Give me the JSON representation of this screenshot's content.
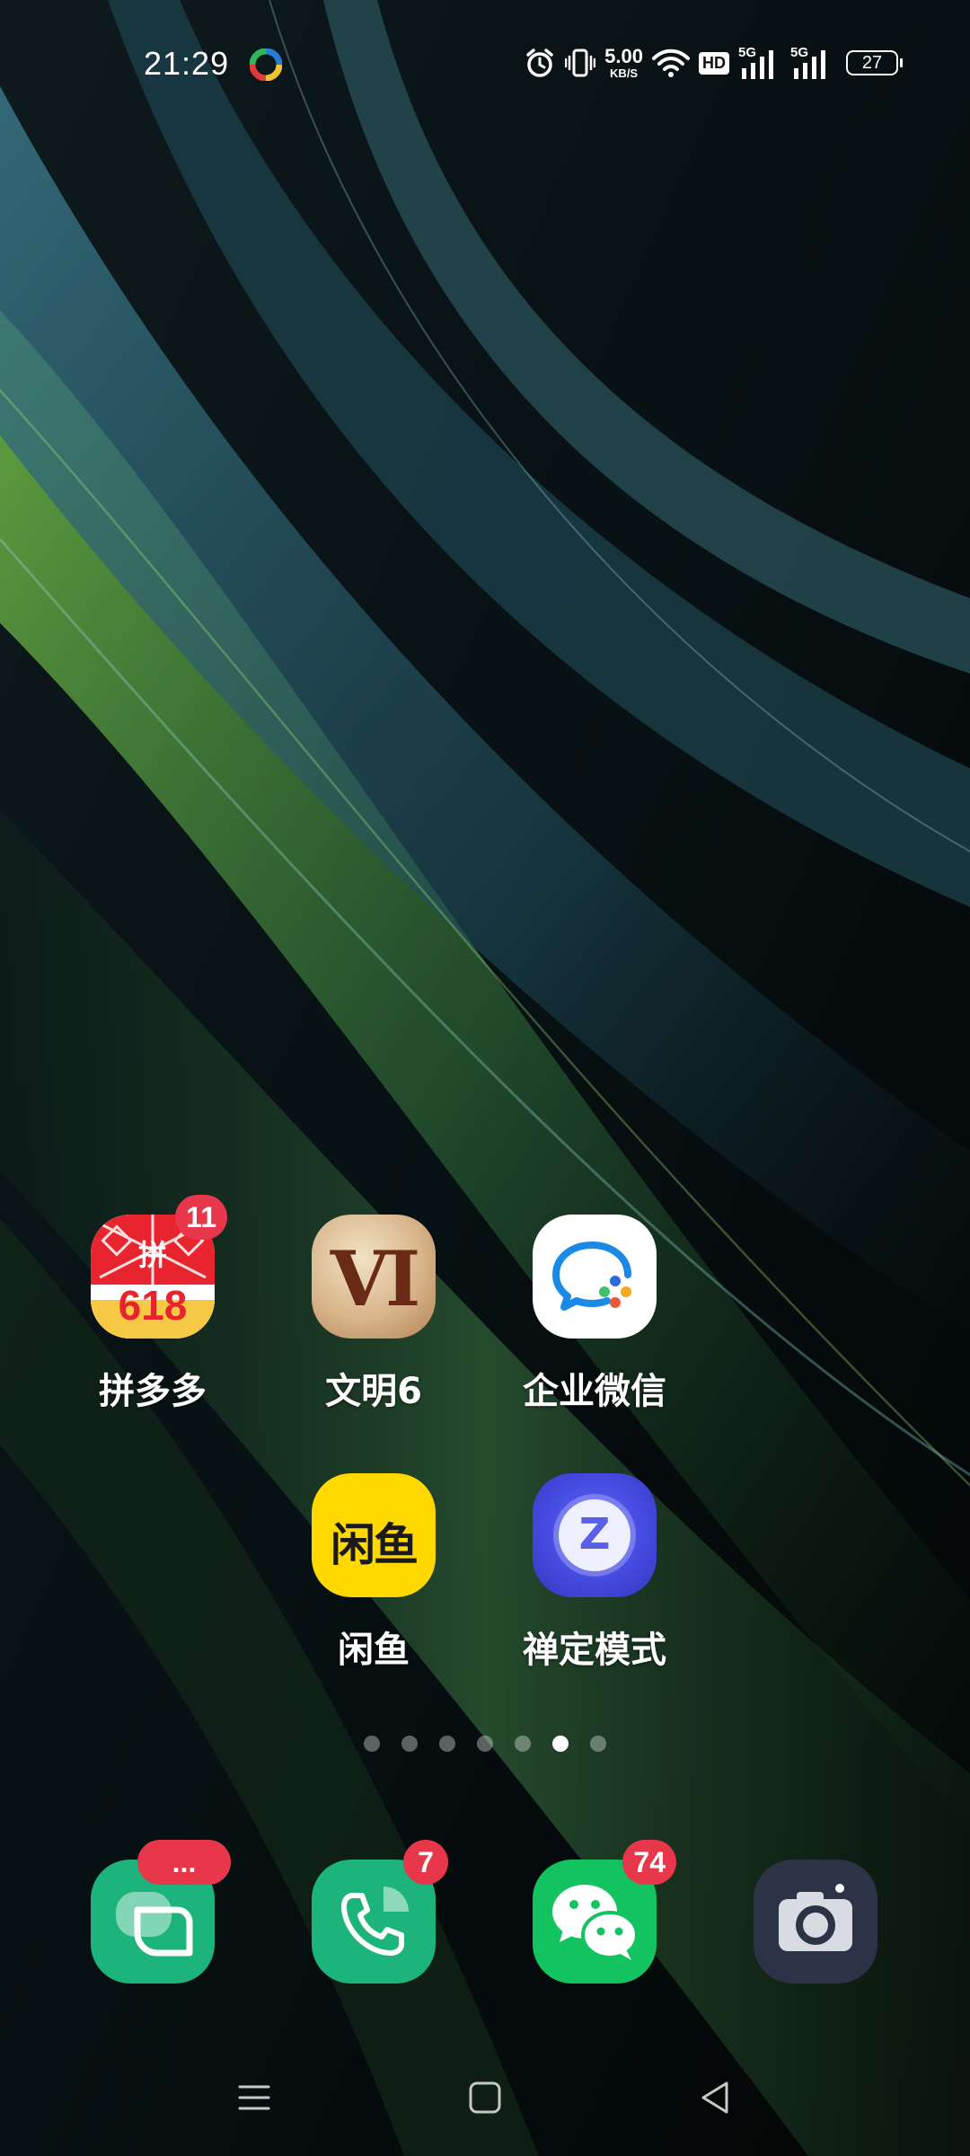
{
  "status_bar": {
    "time": "21:29",
    "net_speed_value": "5.00",
    "net_speed_unit": "KB/S",
    "hd_label": "HD",
    "sim1_label": "5G",
    "sim2_label": "5G",
    "battery_level": "27"
  },
  "apps": [
    {
      "label": "拼多多",
      "badge": "11"
    },
    {
      "label": "文明6",
      "icon_text": "VI"
    },
    {
      "label": "企业微信"
    },
    {
      "label": "闲鱼",
      "icon_text": "闲鱼"
    },
    {
      "label": "禅定模式",
      "icon_text": "Z"
    }
  ],
  "pdd_icon_text": {
    "top": "拼",
    "number": "618"
  },
  "page_indicator": {
    "count": 7,
    "active_index": 5
  },
  "dock": [
    {
      "name": "messages",
      "badge": "..."
    },
    {
      "name": "phone",
      "badge": "7"
    },
    {
      "name": "wechat",
      "badge": "74"
    },
    {
      "name": "camera"
    }
  ],
  "colors": {
    "badge_red": "#e8364b",
    "dock_green": "#1db37c",
    "wechat_green": "#13c35f",
    "xianyu_yellow": "#ffd800",
    "zen_blue": "#4a4fe0",
    "camera_dark": "#2d3347"
  }
}
